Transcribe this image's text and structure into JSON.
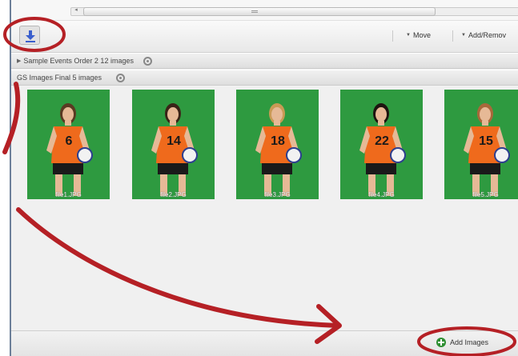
{
  "toolbar": {
    "download_icon": "download-arrow-icon",
    "move_label": "Move",
    "add_remove_label": "Add/Remov"
  },
  "groups": [
    {
      "title": "Sample Events Order 2  12 images"
    },
    {
      "title": "GS Images Final  5 images"
    }
  ],
  "gallery": {
    "images": [
      {
        "filename": "file1.JPG",
        "jersey": "6"
      },
      {
        "filename": "file2.JPG",
        "jersey": "14"
      },
      {
        "filename": "file3.JPG",
        "jersey": "18"
      },
      {
        "filename": "file4.JPG",
        "jersey": "22"
      },
      {
        "filename": "file5.JPG",
        "jersey": "15"
      }
    ]
  },
  "bottom": {
    "add_images_label": "Add Images"
  },
  "colors": {
    "annotation_red": "#b52025",
    "backdrop_green": "#2e9a40",
    "jersey_orange": "#ef6a1c",
    "accent_blue": "#3a5fcd"
  }
}
